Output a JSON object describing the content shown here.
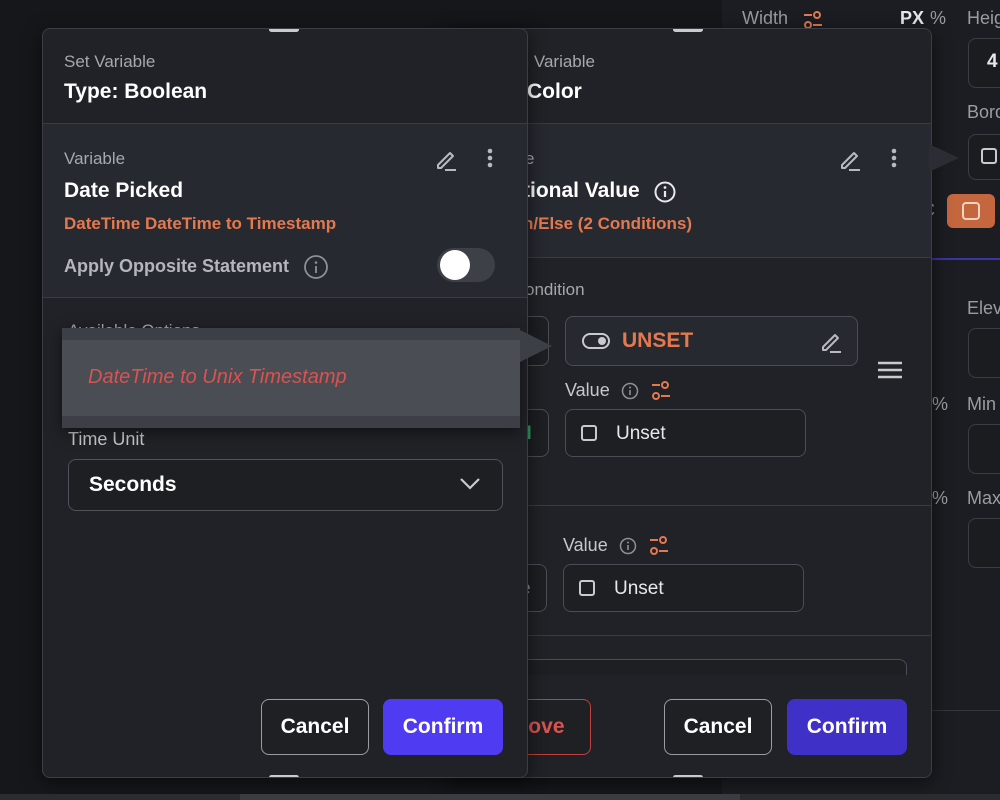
{
  "props": {
    "width_label": "Width",
    "px_label": "PX",
    "pct_label": "%",
    "height_label": "Heig",
    "height_value": "4",
    "border_label": "Bord",
    "c_label": "C",
    "elev_label": "Elev",
    "min_label": "Min",
    "max_label": "Max",
    "pct2": "%",
    "pct3": "%"
  },
  "back_panel": {
    "header_label": "m Variable",
    "header_title": "Color",
    "section_label": "e",
    "section_title": "tional Value",
    "section_sub": "n/Else (2 Conditions)",
    "condition_label": "ondition",
    "condition_value": "UNSET",
    "value1_label": "Value",
    "value1_text": "Unset",
    "value2_label": "Value",
    "value2_text": "Unset",
    "left_fragment": "N",
    "left_fragment2": "e",
    "remove_label": "nove",
    "cancel_label": "Cancel",
    "confirm_label": "Confirm"
  },
  "front_panel": {
    "header_label": "Set Variable",
    "header_title": "Type: Boolean",
    "variable_label": "Variable",
    "variable_title": "Date Picked",
    "variable_sub": "DateTime DateTime to Timestamp",
    "apply_label": "Apply Opposite Statement",
    "apply_toggle": false,
    "options_label": "Available Options",
    "selected_option": "DateTime to Unix Timestamp",
    "time_unit_label": "Time Unit",
    "time_unit_value": "Seconds",
    "cancel_label": "Cancel",
    "confirm_label": "Confirm"
  },
  "colors": {
    "accent": "#4f3cf2",
    "orange": "#e4794f",
    "error_red": "#d9534f"
  }
}
